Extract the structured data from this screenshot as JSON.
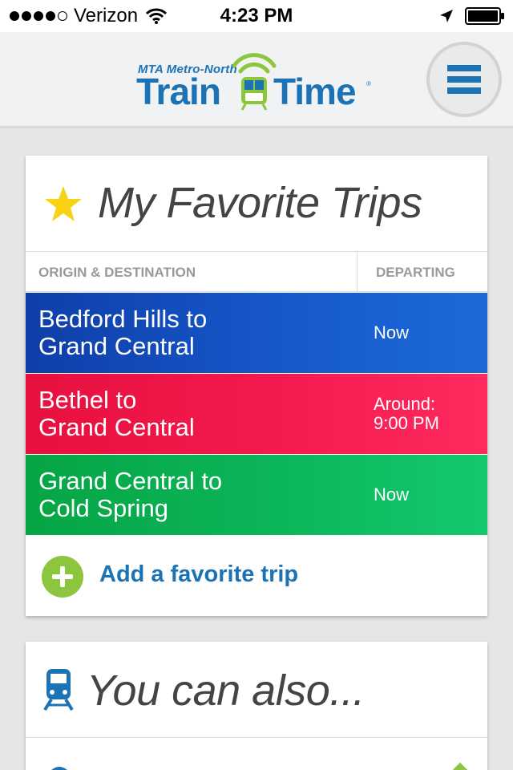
{
  "status_bar": {
    "carrier": "Verizon",
    "time": "4:23 PM",
    "signal_bars_filled": 4,
    "signal_bars_total": 5,
    "battery_level": 0.9
  },
  "header": {
    "logo": {
      "top_line": "MTA Metro-North",
      "word1": "Train",
      "word2": "Time",
      "reg_mark": "®"
    },
    "menu_icon": "hamburger-menu-icon"
  },
  "favorites": {
    "icon": "star-icon",
    "title": "My Favorite Trips",
    "column_headers": {
      "origin_destination": "ORIGIN & DESTINATION",
      "departing": "DEPARTING"
    },
    "trips": [
      {
        "route_line1": "Bedford Hills to",
        "route_line2": "Grand Central",
        "departing_line1": "Now",
        "departing_line2": "",
        "color": "#1658cb"
      },
      {
        "route_line1": "Bethel to",
        "route_line2": "Grand Central",
        "departing_line1": "Around:",
        "departing_line2": "9:00 PM",
        "color": "#f41a4f"
      },
      {
        "route_line1": "Grand Central to",
        "route_line2": "Cold Spring",
        "departing_line1": "Now",
        "departing_line2": "",
        "color": "#0cb65a"
      }
    ],
    "add_label": "Add a favorite trip",
    "add_icon": "plus-circle-icon"
  },
  "also": {
    "icon": "train-icon",
    "title": "You can also..."
  },
  "colors": {
    "brand_blue": "#1b73b6",
    "add_green": "#8cc63f",
    "star_yellow": "#f7d313"
  }
}
